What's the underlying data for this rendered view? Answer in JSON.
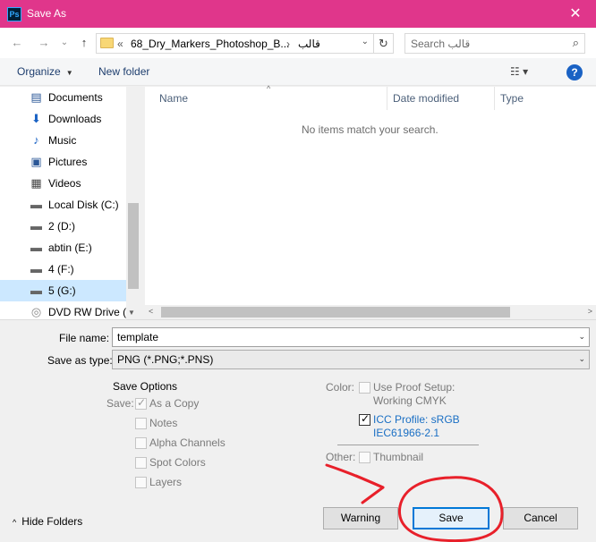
{
  "window": {
    "title": "Save As",
    "app_icon": "Ps",
    "close_glyph": "✕"
  },
  "nav": {
    "back": "←",
    "forward": "→",
    "dropdown": "⌄",
    "up": "↑",
    "breadcrumb_prefix": "«",
    "breadcrumb_1": "68_Dry_Markers_Photoshop_B...",
    "breadcrumb_sep": "›",
    "breadcrumb_2": "قالب",
    "address_dd": "⌄",
    "refresh": "↻",
    "search_placeholder": "Search قالب",
    "search_icon": "⌕"
  },
  "toolbar": {
    "organize": "Organize",
    "organize_caret": "▼",
    "new_folder": "New folder",
    "view_icon": "☷ ▾",
    "help": "?"
  },
  "sidebar": {
    "items": [
      {
        "label": "Documents",
        "icon": "document-icon",
        "glyph": "▤"
      },
      {
        "label": "Downloads",
        "icon": "download-icon",
        "glyph": "⬇"
      },
      {
        "label": "Music",
        "icon": "music-icon",
        "glyph": "♪"
      },
      {
        "label": "Pictures",
        "icon": "pictures-icon",
        "glyph": "▣"
      },
      {
        "label": "Videos",
        "icon": "videos-icon",
        "glyph": "▦"
      },
      {
        "label": "Local Disk (C:)",
        "icon": "drive-icon",
        "glyph": "▬"
      },
      {
        "label": "2 (D:)",
        "icon": "drive-icon",
        "glyph": "▬"
      },
      {
        "label": "abtin (E:)",
        "icon": "drive-icon",
        "glyph": "▬"
      },
      {
        "label": "4 (F:)",
        "icon": "drive-icon",
        "glyph": "▬"
      },
      {
        "label": "5 (G:)",
        "icon": "drive-icon",
        "glyph": "▬"
      },
      {
        "label": "DVD RW Drive (J",
        "icon": "dvd-icon",
        "glyph": "◎"
      }
    ],
    "selected_index": 9,
    "scroll_down": "▼"
  },
  "filelist": {
    "columns": [
      "Name",
      "Date modified",
      "Type"
    ],
    "sort_caret": "^",
    "empty_message": "No items match your search.",
    "scroll_left": "<",
    "scroll_right": ">"
  },
  "form": {
    "filename_label": "File name:",
    "filename_value": "template",
    "savetype_label": "Save as type:",
    "savetype_value": "PNG (*.PNG;*.PNS)",
    "dd": "⌄"
  },
  "save_options": {
    "title": "Save Options",
    "save_label": "Save:",
    "as_copy": "As a Copy",
    "notes": "Notes",
    "alpha_channels": "Alpha Channels",
    "spot_colors": "Spot Colors",
    "layers": "Layers",
    "color_label": "Color:",
    "proof_line1": "Use Proof Setup:",
    "proof_line2": "Working CMYK",
    "icc_line1": "ICC Profile:  sRGB",
    "icc_line2": "IEC61966-2.1",
    "other_label": "Other:",
    "thumbnail": "Thumbnail"
  },
  "footer": {
    "hide_folders": "Hide Folders",
    "hide_chev": "^",
    "warning": "Warning",
    "save": "Save",
    "cancel": "Cancel"
  },
  "annotation": {
    "color": "#e8202a"
  }
}
